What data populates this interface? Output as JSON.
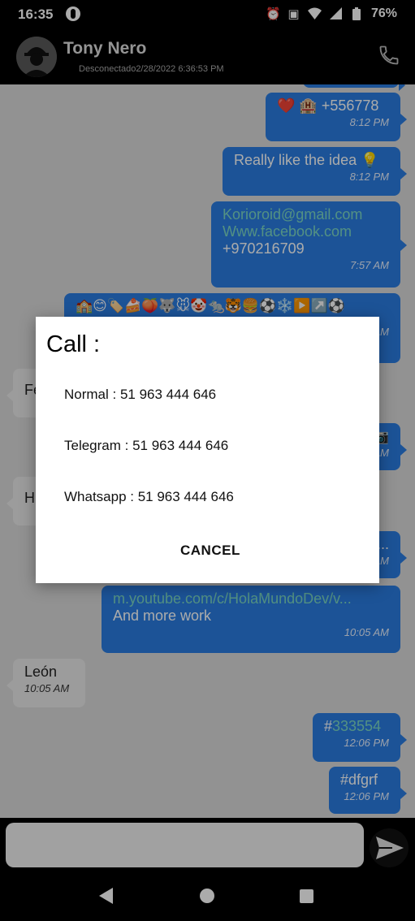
{
  "status_bar": {
    "time": "16:35",
    "battery": "76%",
    "icons": [
      "alarm-icon",
      "vibrate-icon",
      "wifi-icon",
      "signal-icon",
      "battery-icon"
    ]
  },
  "header": {
    "contact_name": "Tony  Nero",
    "status": "Desconectado2/28/2022 6:36:53 PM"
  },
  "messages": [
    {
      "dir": "out",
      "text": "❤️ 🏨 +556778",
      "time": "8:12 PM"
    },
    {
      "dir": "out",
      "text": "Really like the idea 💡",
      "time": "8:12 PM"
    },
    {
      "dir": "out",
      "line1": "Korioroid@gmail.com",
      "line2": "Www.facebook.com",
      "line3": "+970216709",
      "time": "7:57 AM"
    },
    {
      "dir": "out",
      "text": "🏫😊🏷️🍰🍑🐺🐭🤡🐀🐯🍔⚽❄️▶️↗️⚽",
      "time": "AM"
    },
    {
      "dir": "in",
      "text": "Fe"
    },
    {
      "dir": "out",
      "text": "📷",
      "time": "AM"
    },
    {
      "dir": "in",
      "text": "H"
    },
    {
      "dir": "out",
      "text": "...",
      "time": "AM"
    },
    {
      "dir": "out",
      "line1": "m.youtube.com/c/HolaMundoDev/v...",
      "line2": "And more work",
      "time": "10:05 AM"
    },
    {
      "dir": "in",
      "text": "León",
      "time": "10:05 AM"
    },
    {
      "dir": "out",
      "hash": "#",
      "link": "333554",
      "time": "12:06 PM"
    },
    {
      "dir": "out",
      "text": "#dfgrf",
      "time": "12:06 PM"
    }
  ],
  "composer": {
    "placeholder": ""
  },
  "dialog": {
    "title": "Call :",
    "options": [
      "Normal : 51 963 444 646",
      "Telegram : 51 963 444 646",
      "Whatsapp : 51 963 444 646"
    ],
    "cancel_label": "CANCEL"
  },
  "colors": {
    "outgoing_bubble": "#2a7de1",
    "incoming_bubble": "#e9e9e9",
    "link": "#7dd8c4"
  }
}
